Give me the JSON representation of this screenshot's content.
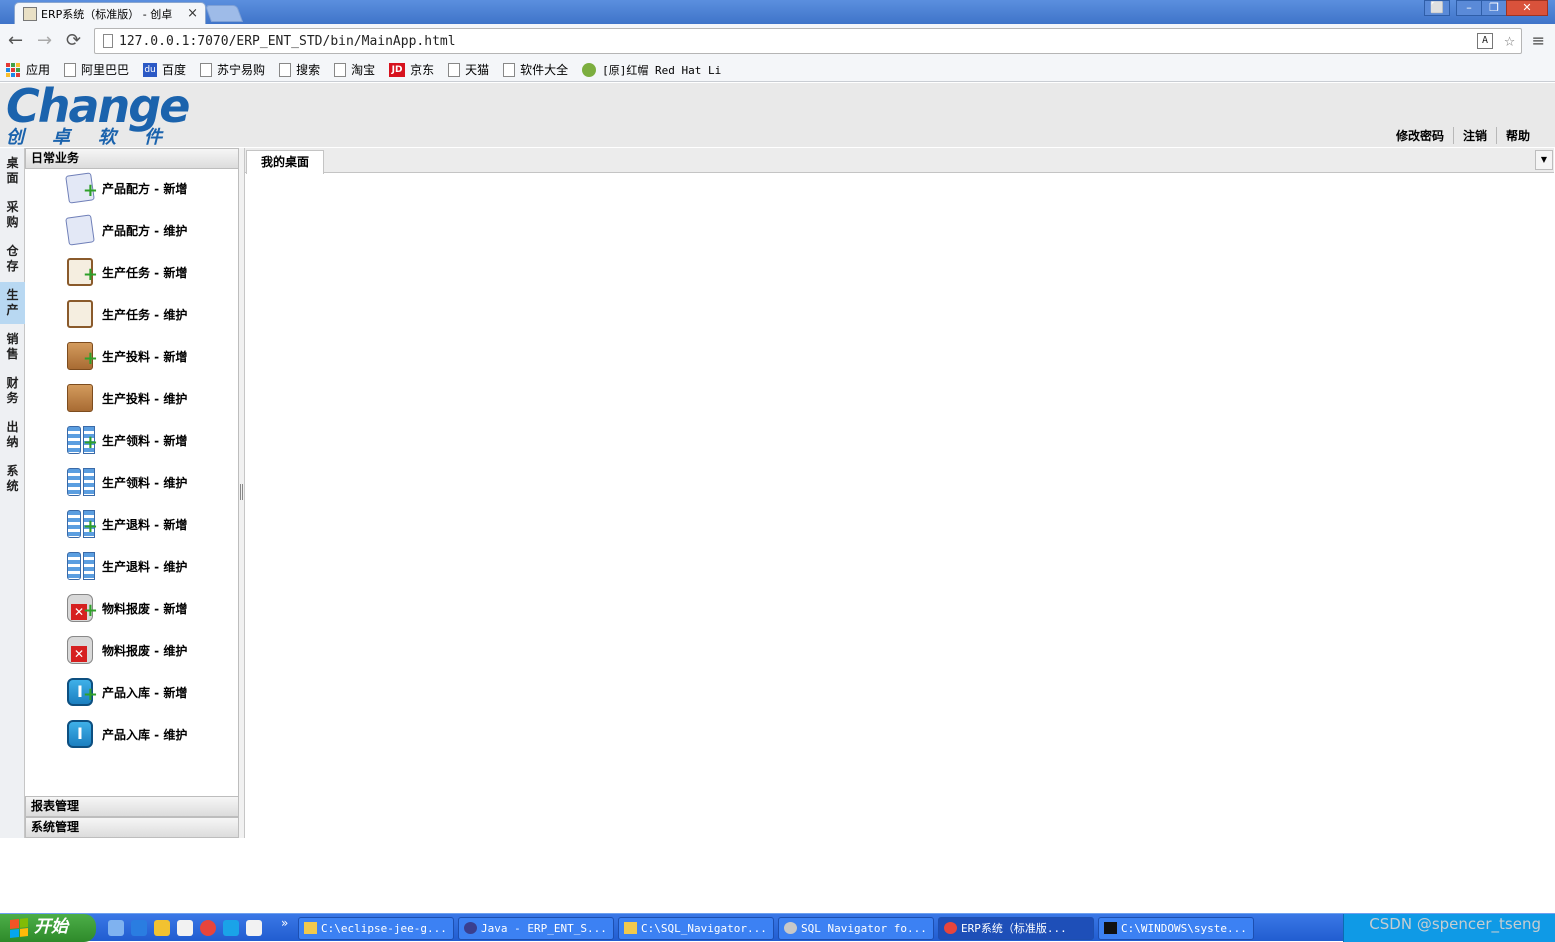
{
  "browser": {
    "tab_title": "ERP系统（标准版） - 创卓",
    "tab_close": "×",
    "url": "127.0.0.1:7070/ERP_ENT_STD/bin/MainApp.html",
    "nav": {
      "back": "←",
      "forward": "→",
      "reload": "⟳",
      "menu": "≡",
      "star": "☆"
    },
    "window_buttons": [
      "⬜",
      "–",
      "❐",
      "✕"
    ],
    "bookmarks": [
      {
        "label": "应用",
        "icon": "apps-icon"
      },
      {
        "label": "阿里巴巴",
        "icon": "page-icon"
      },
      {
        "label": "百度",
        "icon": "baidu-icon"
      },
      {
        "label": "苏宁易购",
        "icon": "page-icon"
      },
      {
        "label": "搜索",
        "icon": "page-icon"
      },
      {
        "label": "淘宝",
        "icon": "page-icon"
      },
      {
        "label": "京东",
        "icon": "jd-icon"
      },
      {
        "label": "天猫",
        "icon": "page-icon"
      },
      {
        "label": "软件大全",
        "icon": "page-icon"
      },
      {
        "label": "[原]红帽 Red Hat Li",
        "icon": "redhat-icon"
      }
    ]
  },
  "app": {
    "logo_word": "Change",
    "logo_sub": "创卓软件",
    "top_links": [
      "修改密码",
      "注销",
      "帮助"
    ],
    "modules": [
      "桌面",
      "采购",
      "仓存",
      "生产",
      "销售",
      "财务",
      "出纳",
      "系统"
    ],
    "active_module": "生产",
    "panel_title": "日常业务",
    "nav_items": [
      {
        "label": "产品配方 - 新增",
        "icon": "formula-add-icon"
      },
      {
        "label": "产品配方 - 维护",
        "icon": "formula-icon"
      },
      {
        "label": "生产任务 - 新增",
        "icon": "task-add-icon"
      },
      {
        "label": "生产任务 - 维护",
        "icon": "task-icon"
      },
      {
        "label": "生产投料 - 新增",
        "icon": "feed-add-icon"
      },
      {
        "label": "生产投料 - 维护",
        "icon": "feed-icon"
      },
      {
        "label": "生产领料 - 新增",
        "icon": "pick-add-icon"
      },
      {
        "label": "生产领料 - 维护",
        "icon": "pick-icon"
      },
      {
        "label": "生产退料 - 新增",
        "icon": "return-add-icon"
      },
      {
        "label": "生产退料 - 维护",
        "icon": "return-icon"
      },
      {
        "label": "物料报废 - 新增",
        "icon": "scrap-add-icon"
      },
      {
        "label": "物料报废 - 维护",
        "icon": "scrap-icon"
      },
      {
        "label": "产品入库 - 新增",
        "icon": "stockin-add-icon"
      },
      {
        "label": "产品入库 - 维护",
        "icon": "stockin-icon"
      }
    ],
    "collapsed_panels": [
      "报表管理",
      "系统管理"
    ],
    "desktop_tab": "我的桌面",
    "tab_dropdown": "▼"
  },
  "taskbar": {
    "start_label": "开始",
    "overflow": "»",
    "windows": [
      {
        "label": "C:\\eclipse-jee-g...",
        "icon": "folder-icon",
        "active": false
      },
      {
        "label": "Java - ERP_ENT_S...",
        "icon": "eclipse-icon",
        "active": false
      },
      {
        "label": "C:\\SQL_Navigator...",
        "icon": "folder-icon",
        "active": false
      },
      {
        "label": "SQL Navigator fo...",
        "icon": "sqlnav-icon",
        "active": false
      },
      {
        "label": "ERP系统（标准版...",
        "icon": "chrome-icon",
        "active": true
      },
      {
        "label": "C:\\WINDOWS\\syste...",
        "icon": "cmd-icon",
        "active": false
      }
    ],
    "watermark": "CSDN @spencer_tseng"
  }
}
